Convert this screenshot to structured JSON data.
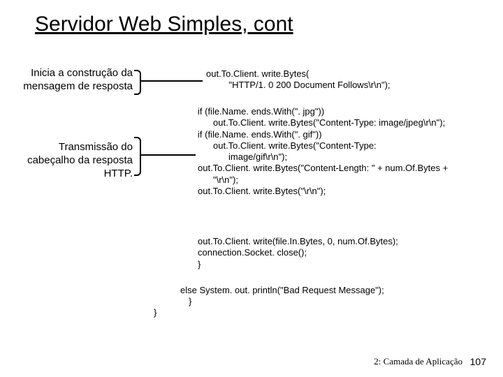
{
  "title": "Servidor Web Simples, cont",
  "label1_line1": "Inicia a construção da",
  "label1_line2": "mensagem de resposta",
  "label2_line1": "Transmissão do",
  "label2_line2": "cabeçalho da resposta",
  "label2_line3": "HTTP.",
  "code1_line1": "out.To.Client. write.Bytes(",
  "code1_line2": "         \"HTTP/1. 0 200 Document Follows\\r\\n\");",
  "code2_l1": "if (file.Name. ends.With(\". jpg\"))",
  "code2_l2": "out.To.Client. write.Bytes(\"Content-Type: image/jpeg\\r\\n\");",
  "code2_l3": "if (file.Name. ends.With(\". gif\"))",
  "code2_l4": "out.To.Client. write.Bytes(\"Content-Type:",
  "code2_l5": "image/gif\\r\\n\");",
  "code2_l6": "out.To.Client. write.Bytes(\"Content-Length: \" + num.Of.Bytes +",
  "code2_l7": "\"\\r\\n\");",
  "code2_l8": "out.To.Client. write.Bytes(\"\\r\\n\");",
  "code3_l1": "out.To.Client. write(file.In.Bytes, 0, num.Of.Bytes);",
  "code3_l2": "connection.Socket. close();",
  "code3_l3": "}",
  "code4": "else System. out. println(\"Bad Request Message\");",
  "code5": "}",
  "code6": "}",
  "footer_chapter": "2: Camada de Aplicação",
  "footer_page": "107"
}
